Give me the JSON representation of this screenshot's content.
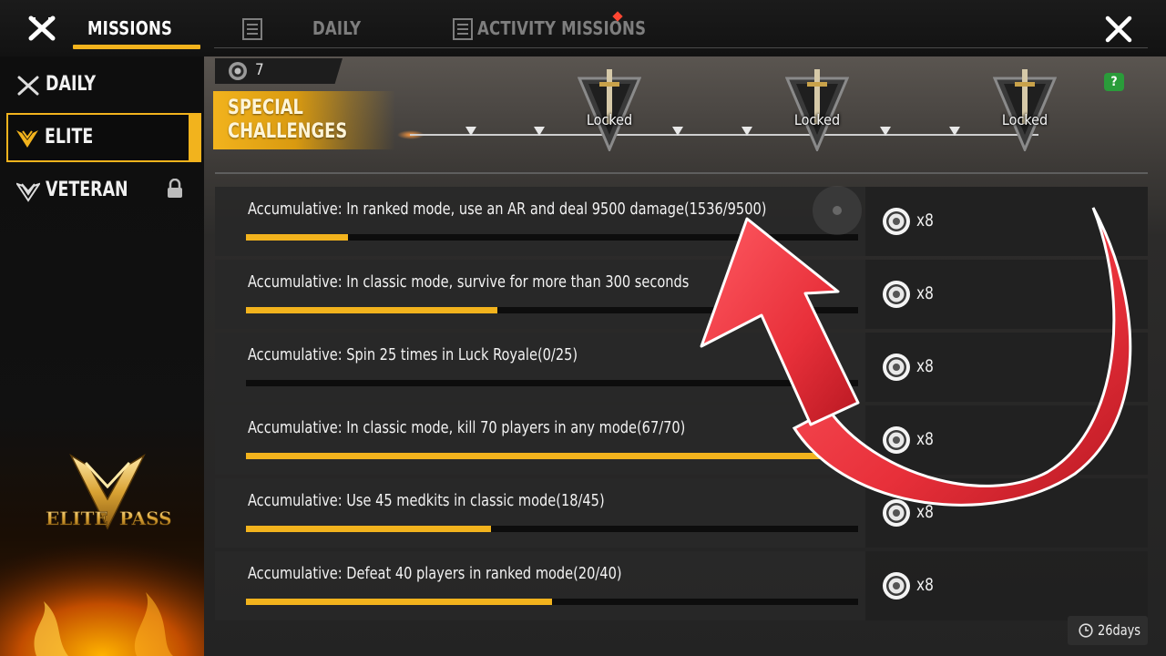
{
  "header": {
    "tabs": [
      {
        "label": "MISSIONS",
        "active": true
      },
      {
        "label": "DAILY",
        "active": false
      },
      {
        "label": "ACTIVITY MISSIONS",
        "active": false,
        "has_notification": true
      }
    ],
    "close_icon": "close-icon"
  },
  "sidebar": {
    "items": [
      {
        "label": "DAILY",
        "icon": "crossed-swords-icon",
        "selected": false
      },
      {
        "label": "ELITE",
        "icon": "elite-wings-icon",
        "selected": true
      },
      {
        "label": "VETERAN",
        "icon": "veteran-wings-icon",
        "selected": false,
        "locked": true
      }
    ],
    "logo_text": "ELITE PASS"
  },
  "special": {
    "token_count": "7",
    "banner": "SPECIAL CHALLENGES",
    "milestones": [
      {
        "label": "Locked"
      },
      {
        "label": "Locked"
      },
      {
        "label": "Locked"
      }
    ],
    "help": "?"
  },
  "missions": [
    {
      "text": "Accumulative: In ranked mode, use an AR and deal 9500 damage(1536/9500)",
      "progress": 0.167,
      "reward": "x8"
    },
    {
      "text": "Accumulative: In classic mode, survive for more than 300 seconds",
      "progress": 0.41,
      "reward": "x8"
    },
    {
      "text": "Accumulative: Spin 25 times in Luck Royale(0/25)",
      "progress": 0.0,
      "reward": "x8"
    },
    {
      "text": "Accumulative: In classic mode, kill 70 players in any mode(67/70)",
      "progress": 0.957,
      "reward": "x8"
    },
    {
      "text": "Accumulative: Use 45 medkits in classic mode(18/45)",
      "progress": 0.4,
      "reward": "x8"
    },
    {
      "text": "Accumulative: Defeat 40 players in ranked mode(20/40)",
      "progress": 0.5,
      "reward": "x8"
    }
  ],
  "timer": {
    "value": "26days",
    "icon": "clock-icon"
  },
  "colors": {
    "accent": "#f2b31d",
    "arrow": "#e8303a",
    "help_badge": "#2a9c3a"
  }
}
